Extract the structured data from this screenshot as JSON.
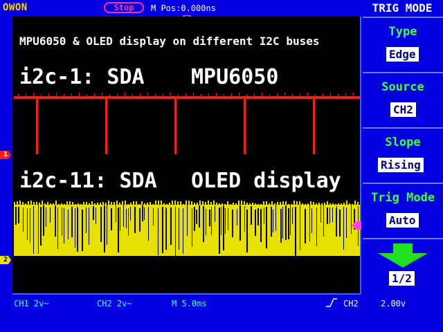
{
  "topbar": {
    "brand": "OWON",
    "run_state": "Stop",
    "mpos": "M Pos:0.000ns"
  },
  "screen": {
    "title": "MPU6050 & OLED display on different I2C buses",
    "ch1_left": "i2c-1: SDA",
    "ch1_right": "MPU6050",
    "ch2_left": "i2c-11: SDA",
    "ch2_right": "OLED display",
    "trigger_marker": "T",
    "ch1_marker": "1",
    "ch2_marker": "2",
    "ch1_color": "#ee2020",
    "ch2_color": "#e8e000"
  },
  "statusbar": {
    "ch1": "CH1 2v~",
    "ch2": "CH2 2v~",
    "timebase": "M 5.0ms",
    "trig_source": "CH2",
    "trig_level": "2.00v"
  },
  "sidebar": {
    "header": "TRIG MODE",
    "items": [
      {
        "label": "Type",
        "value": "Edge"
      },
      {
        "label": "Source",
        "value": "CH2"
      },
      {
        "label": "Slope",
        "value": "Rising"
      },
      {
        "label": "Trig Mode",
        "value": "Auto"
      }
    ],
    "page": "1/2"
  }
}
